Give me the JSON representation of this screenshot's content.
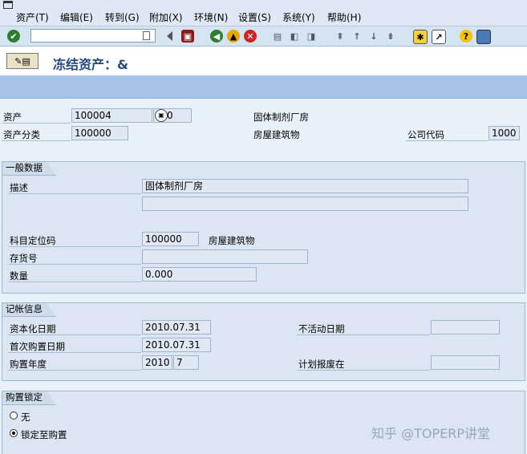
{
  "menu": [
    "资产(T)",
    "编辑(E)",
    "转到(G)",
    "附加(X)",
    "环境(N)",
    "设置(S)",
    "系统(Y)",
    "帮助(H)"
  ],
  "title": "冻结资产：&",
  "header": {
    "asset_label": "资产",
    "asset_value": "100004",
    "asset_sub": "0",
    "asset_desc": "固体制剂厂房",
    "class_label": "资产分类",
    "class_value": "100000",
    "class_desc": "房屋建筑物",
    "company_label": "公司代码",
    "company_value": "1000"
  },
  "general": {
    "tab": "一般数据",
    "desc_label": "描述",
    "desc_value": "固体制剂厂房",
    "desc_value2": "",
    "acct_label": "科目定位码",
    "acct_value": "100000",
    "acct_desc": "房屋建筑物",
    "inv_label": "存货号",
    "inv_value": "",
    "qty_label": "数量",
    "qty_value": "0.000"
  },
  "posting": {
    "tab": "记帐信息",
    "cap_label": "资本化日期",
    "cap_value": "2010.07.31",
    "inactive_label": "不活动日期",
    "inactive_value": "",
    "first_label": "首次购置日期",
    "first_value": "2010.07.31",
    "year_label": "购置年度",
    "year_value": "2010",
    "period_value": "7",
    "retire_label": "计划报废在",
    "retire_value": ""
  },
  "lock": {
    "tab": "购置锁定",
    "opt_none": "无",
    "opt_lock": "锁定至购置",
    "selected": "opt_lock"
  },
  "watermark": "知乎 @TOPERP讲堂",
  "colors": {
    "accent": "#a7c4e6",
    "group_bg": "#dbe6f2"
  }
}
